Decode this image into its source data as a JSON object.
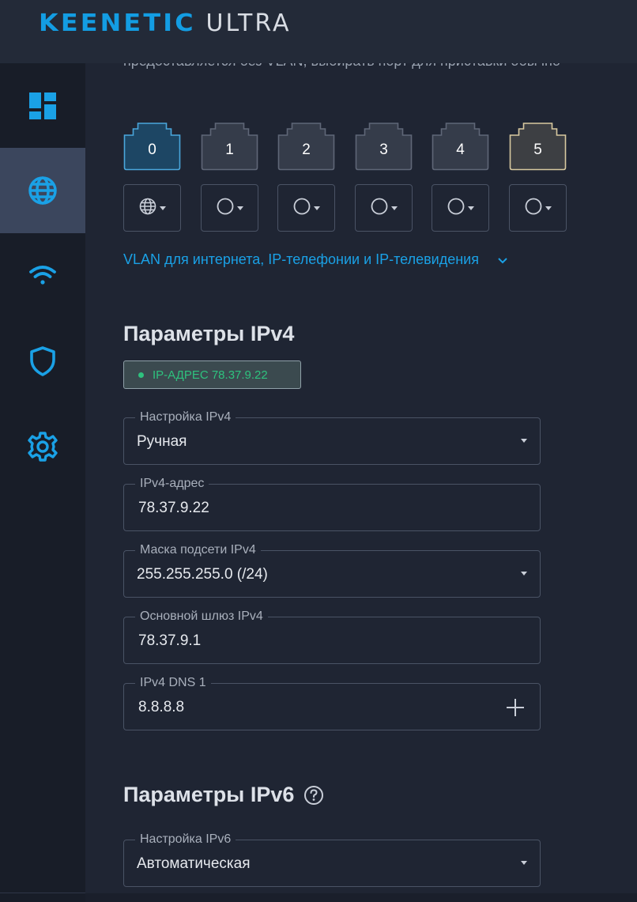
{
  "header": {
    "brand": "KEENETIC",
    "model": "ULTRA"
  },
  "sidebar": {
    "items": [
      {
        "name": "dashboard",
        "icon": "dashboard-icon",
        "active": false
      },
      {
        "name": "internet",
        "icon": "globe-icon",
        "active": true
      },
      {
        "name": "wifi",
        "icon": "wifi-icon",
        "active": false
      },
      {
        "name": "security",
        "icon": "shield-icon",
        "active": false
      },
      {
        "name": "settings",
        "icon": "gear-icon",
        "active": false
      }
    ]
  },
  "main": {
    "cut_text": "предоставляется без VLAN, выбирать порт для приставки обычно",
    "ports": [
      {
        "number": "0",
        "mode_icon": "globe-icon",
        "state": "selected"
      },
      {
        "number": "1",
        "mode_icon": "circle-icon",
        "state": "normal"
      },
      {
        "number": "2",
        "mode_icon": "circle-icon",
        "state": "normal"
      },
      {
        "number": "3",
        "mode_icon": "circle-icon",
        "state": "normal"
      },
      {
        "number": "4",
        "mode_icon": "circle-icon",
        "state": "normal"
      },
      {
        "number": "5",
        "mode_icon": "circle-icon",
        "state": "highlighted"
      }
    ],
    "vlan_link": "VLAN для интернета, IP-телефонии и IP-телевидения",
    "ipv4": {
      "title": "Параметры IPv4",
      "badge": "IP-АДРЕС 78.37.9.22",
      "fields": {
        "setup": {
          "label": "Настройка IPv4",
          "value": "Ручная"
        },
        "address": {
          "label": "IPv4-адрес",
          "value": "78.37.9.22"
        },
        "mask": {
          "label": "Маска подсети IPv4",
          "value": "255.255.255.0 (/24)"
        },
        "gateway": {
          "label": "Основной шлюз IPv4",
          "value": "78.37.9.1"
        },
        "dns1": {
          "label": "IPv4 DNS 1",
          "value": "8.8.8.8"
        }
      }
    },
    "ipv6": {
      "title": "Параметры IPv6",
      "setup": {
        "label": "Настройка IPv6",
        "value": "Автоматическая"
      }
    }
  },
  "colors": {
    "accent": "#139de3",
    "background": "#1f2533",
    "sidebar": "#181d28",
    "sidebar_active": "#3b465d",
    "status_ok": "#2ec27e",
    "port_selected": "#1c4a6e",
    "port_highlight": "#d8c9a0"
  }
}
